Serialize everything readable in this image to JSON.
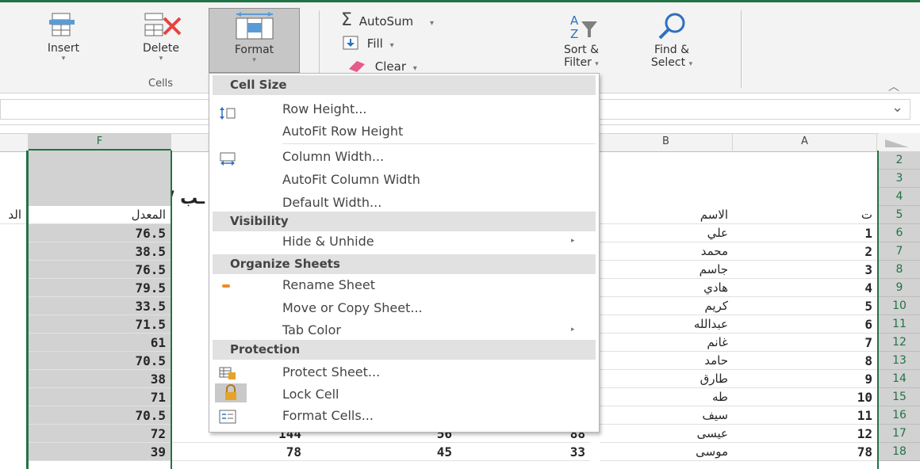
{
  "ribbon": {
    "insert_label": "Insert",
    "delete_label": "Delete",
    "format_label": "Format",
    "cells_group_label": "Cells",
    "autosum_label": "AutoSum",
    "fill_label": "Fill",
    "clear_label": "Clear",
    "sort_filter_label_1": "Sort &",
    "sort_filter_label_2": "Filter",
    "find_select_label_1": "Find &",
    "find_select_label_2": "Select",
    "dropdown_arrow": "▾",
    "collapse_glyph": "︿",
    "expand_glyph": "⌄"
  },
  "columns": {
    "f": "F",
    "b": "B",
    "a": "A"
  },
  "sheet": {
    "title_fragment": "ـب / اطلاب",
    "header_row": {
      "col_g": "الد",
      "col_f": "المعدل",
      "col_b": "الاسم",
      "col_a": "ت"
    },
    "row_numbers": [
      "2",
      "3",
      "4",
      "5",
      "6",
      "7",
      "8",
      "9",
      "10",
      "11",
      "12",
      "13",
      "14",
      "15",
      "16",
      "17",
      "18"
    ],
    "rows": [
      {
        "f": "76.5",
        "name": "علي",
        "num": "1"
      },
      {
        "f": "38.5",
        "name": "محمد",
        "num": "2"
      },
      {
        "f": "76.5",
        "name": "جاسم",
        "num": "3"
      },
      {
        "f": "79.5",
        "name": "هادي",
        "num": "4"
      },
      {
        "f": "33.5",
        "name": "كريم",
        "num": "5"
      },
      {
        "f": "71.5",
        "name": "عبدالله",
        "num": "6"
      },
      {
        "f": "61",
        "name": "غانم",
        "num": "7"
      },
      {
        "f": "70.5",
        "name": "حامد",
        "num": "8"
      },
      {
        "f": "38",
        "name": "طارق",
        "num": "9"
      },
      {
        "f": "71",
        "name": "طه",
        "num": "10"
      },
      {
        "f": "70.5",
        "name": "سيف",
        "num": "11"
      },
      {
        "f": "72",
        "e": "144",
        "d": "56",
        "c": "88",
        "name": "عيسى",
        "num": "12"
      },
      {
        "f": "39",
        "e": "78",
        "d": "45",
        "c": "33",
        "name": "موسى",
        "num": "78"
      }
    ]
  },
  "menu": {
    "cell_size": "Cell Size",
    "row_height": "Row Height...",
    "autofit_row_height": "AutoFit Row Height",
    "column_width": "Column Width...",
    "autofit_column_width": "AutoFit Column Width",
    "default_width": "Default Width...",
    "visibility": "Visibility",
    "hide_unhide": "Hide & Unhide",
    "organize_sheets": "Organize Sheets",
    "rename_sheet": "Rename Sheet",
    "move_copy_sheet": "Move or Copy Sheet...",
    "tab_color": "Tab Color",
    "protection": "Protection",
    "protect_sheet": "Protect Sheet...",
    "lock_cell": "Lock Cell",
    "format_cells": "Format Cells...",
    "submenu_arrow": "▸"
  },
  "colors": {
    "accent": "#217346",
    "selection_gray": "#d2d2d2",
    "lock_icon_bg": "#c9c9c9",
    "orange_bullet": "#f08a24"
  }
}
